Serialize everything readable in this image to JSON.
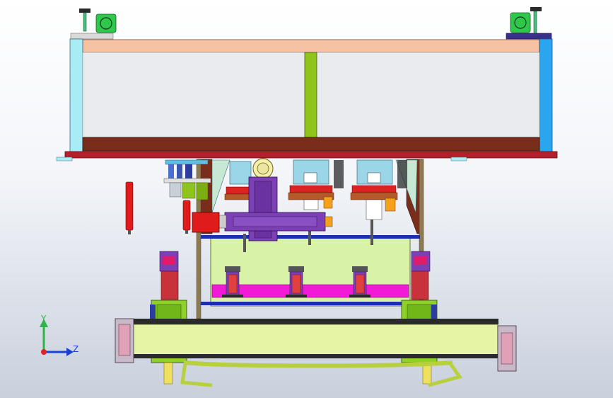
{
  "viewport": {
    "type": "cad-3d-assembly-view",
    "background_top": "#ffffff",
    "background_bottom": "#c9d0dc"
  },
  "triad": {
    "y_label": "Y",
    "z_label": "Z",
    "colors": {
      "y": "#2fb34a",
      "z": "#1b3fd6",
      "origin": "#e0202a"
    }
  },
  "colors": {
    "top_beam": "#f7c1a3",
    "bottom_beam": "#7a2d1a",
    "left_column": "#a9ecf6",
    "right_column": "#2aa6f0",
    "center_post": "#8fc51a",
    "base_plate": "#b3202a",
    "inner_panel": "#d8f2a8",
    "magenta_bar": "#f21ad6",
    "rail_body": "#e6f4a6",
    "purple_block": "#7d3fb5",
    "red_motor": "#e01b1b",
    "blue_rail": "#1a2fb0"
  }
}
